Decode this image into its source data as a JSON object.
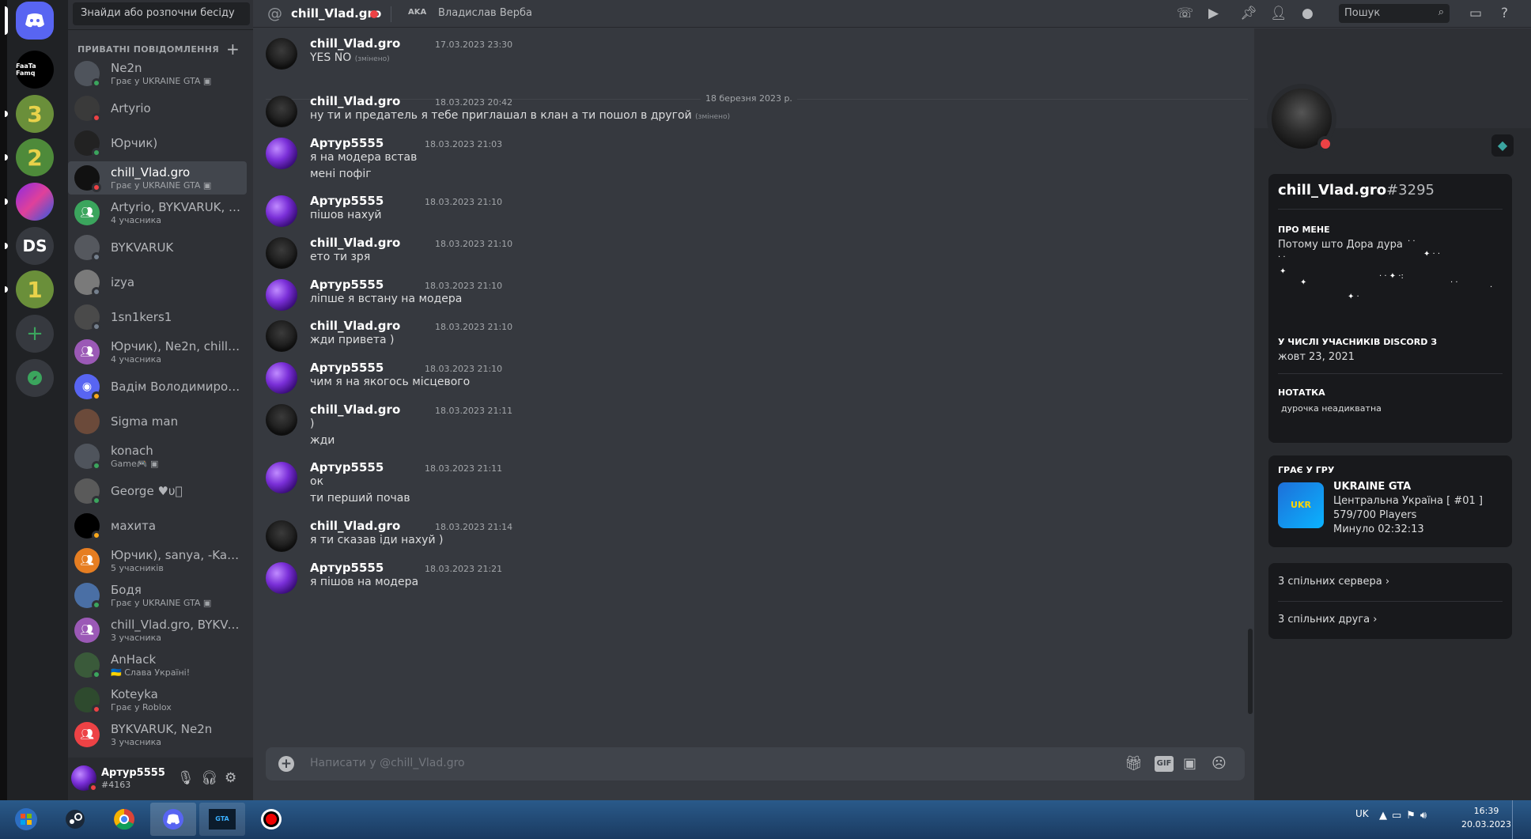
{
  "sidebar_search": "Знайди або розпочни бесіду",
  "dm_header": "ПРИВАТНІ ПОВІДОМЛЕННЯ",
  "servers": [
    {
      "label": "FaaTa Famq"
    },
    {
      "label": "3"
    },
    {
      "label": "2"
    },
    {
      "label": ""
    },
    {
      "label": "DS"
    },
    {
      "label": "1"
    }
  ],
  "dms": [
    {
      "name": "Ne2n",
      "sub": "Грає у UKRAINE GTA ▣",
      "status": "on"
    },
    {
      "name": "Artyrio",
      "sub": "",
      "status": "dnd"
    },
    {
      "name": "Юрчик)",
      "sub": "",
      "status": "on"
    },
    {
      "name": "chill_Vlad.gro",
      "sub": "Грає у UKRAINE GTA ▣",
      "status": "dnd"
    },
    {
      "name": "Artyrio, BYKVARUK, Ю...",
      "sub": "4 учасника",
      "status": ""
    },
    {
      "name": "BYKVARUK",
      "sub": "",
      "status": "off"
    },
    {
      "name": "izya",
      "sub": "",
      "status": "off"
    },
    {
      "name": "1sn1kers1",
      "sub": "",
      "status": "off"
    },
    {
      "name": "Юрчик), Ne2n, chill_Vl...",
      "sub": "4 учасника",
      "status": ""
    },
    {
      "name": "Вадім Володимирович",
      "sub": "",
      "status": "idle"
    },
    {
      "name": "Sigma man",
      "sub": "",
      "status": ""
    },
    {
      "name": "konach",
      "sub": "Game🎮 ▣",
      "status": "on"
    },
    {
      "name": "George ♥υ⃝",
      "sub": "",
      "status": "on"
    },
    {
      "name": "махита",
      "sub": "",
      "status": "idle"
    },
    {
      "name": "Юрчик), sanya, -Kalist...",
      "sub": "5 учасників",
      "status": ""
    },
    {
      "name": "Бодя",
      "sub": "Грає у UKRAINE GTA ▣",
      "status": "on"
    },
    {
      "name": "chill_Vlad.gro, BYKVAR...",
      "sub": "3 учасника",
      "status": ""
    },
    {
      "name": "AnHack",
      "sub": "🇺🇦 Слава Україні!",
      "status": "on"
    },
    {
      "name": "Koteyka",
      "sub": "Грає у Roblox",
      "status": "dnd"
    },
    {
      "name": "BYKVARUK, Ne2n",
      "sub": "3 учасника",
      "status": ""
    }
  ],
  "user": {
    "name": "Артур5555",
    "tag": "#4163"
  },
  "header": {
    "title": "chill_Vlad.gro",
    "aka": "AKA",
    "nickname": "Владислав Верба",
    "search": "Пошук"
  },
  "date_divider": "18 березня 2023 р.",
  "messages": [
    {
      "author": "chill_Vlad.gro",
      "time": "17.03.2023 23:30",
      "lines": [
        "YES NO"
      ],
      "edited": "(змінено)"
    },
    {
      "author": "chill_Vlad.gro",
      "time": "18.03.2023 20:42",
      "lines": [
        "ну ти и предатель я тебе приглашал в  клан а ти пошол в другой"
      ],
      "edited": "(змінено)"
    },
    {
      "author": "Артур5555",
      "time": "18.03.2023 21:03",
      "lines": [
        "я на модера встав",
        "мені пофіг"
      ]
    },
    {
      "author": "Артур5555",
      "time": "18.03.2023 21:10",
      "lines": [
        "пішов нахуй"
      ]
    },
    {
      "author": "chill_Vlad.gro",
      "time": "18.03.2023 21:10",
      "lines": [
        "ето ти зря"
      ]
    },
    {
      "author": "Артур5555",
      "time": "18.03.2023 21:10",
      "lines": [
        "ліпше я встану на модера"
      ]
    },
    {
      "author": "chill_Vlad.gro",
      "time": "18.03.2023 21:10",
      "lines": [
        "жди привета )"
      ]
    },
    {
      "author": "Артур5555",
      "time": "18.03.2023 21:10",
      "lines": [
        "чим я на якогось місцевого"
      ]
    },
    {
      "author": "chill_Vlad.gro",
      "time": "18.03.2023 21:11",
      "lines": [
        ")",
        "жди"
      ]
    },
    {
      "author": "Артур5555",
      "time": "18.03.2023 21:11",
      "lines": [
        "ок",
        "ти перший почав"
      ]
    },
    {
      "author": "chill_Vlad.gro",
      "time": "18.03.2023 21:14",
      "lines": [
        "я ти сказав іди нахуй )"
      ]
    },
    {
      "author": "Артур5555",
      "time": "18.03.2023 21:21",
      "lines": [
        "я пішов на модера"
      ]
    }
  ],
  "composer_placeholder": "Написати у @chill_Vlad.gro",
  "gif": "GIF",
  "profile": {
    "name": "chill_Vlad.gro",
    "discriminator": "#3295",
    "about_label": "ПРО МЕНЕ",
    "about": "Потому што  Дора дура",
    "member_label": "У ЧИСЛІ УЧАСНИКІВ DISCORD З",
    "member_since": "жовт 23, 2021",
    "note_label": "НОТАТКА",
    "note": "дурочка неадикватна",
    "playing_label": "ГРАЄ У ГРУ",
    "game": "UKRAINE GTA",
    "game_detail1": "Центральна Україна [ #01 ]",
    "game_detail2": "579/700 Players",
    "game_elapsed": "Минуло 02:32:13",
    "mutual_servers": "3 спільних сервера",
    "mutual_friends": "3 спільних друга"
  },
  "taskbar": {
    "lang": "UK",
    "time": "16:39",
    "date": "20.03.2023"
  }
}
